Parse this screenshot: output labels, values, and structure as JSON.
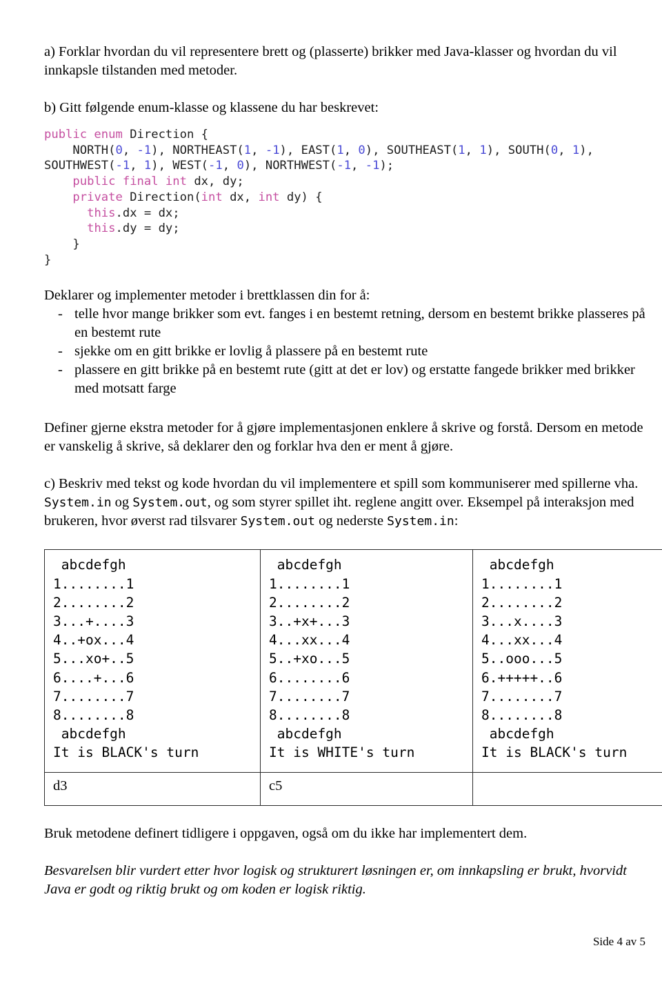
{
  "document": {
    "language": "no",
    "footer": "Side 4 av 5"
  },
  "sections": {
    "task_a": "a) Forklar hvordan du vil representere brett og (plasserte) brikker med Java-klasser og hvordan du vil innkapsle tilstanden med metoder.",
    "task_b_intro": "b) Gitt følgende enum-klasse og klassene du har beskrevet:",
    "declare_intro": "Deklarer og implementer metoder i brettklassen din for å:",
    "extra_methods": "Definer gjerne ekstra metoder for å gjøre implementasjonen enklere å skrive og forstå. Dersom en metode er vanskelig å skrive, så deklarer den og forklar hva den er ment å gjøre.",
    "use_methods": "Bruk metodene definert tidligere i oppgaven, også om du ikke har implementert dem.",
    "grading_note": "Besvarelsen blir vurdert etter hvor logisk og strukturert løsningen er, om innkapsling er brukt, hvorvidt Java er godt og riktig brukt og om koden er logisk riktig."
  },
  "task_c": {
    "part1": "c) Beskriv med tekst og kode hvordan du vil implementere et spill som kommuniserer med spillerne vha. ",
    "code1": "System.in",
    "part2": " og ",
    "code2": "System.out",
    "part3": ", og som styrer spillet iht. reglene angitt over. Eksempel på interaksjon med brukeren, hvor øverst rad tilsvarer ",
    "code3": "System.out",
    "part4": " og nederste ",
    "code4": "System.in",
    "part5": ":"
  },
  "bullets": [
    {
      "marker": "-",
      "text": "telle hvor mange brikker som evt. fanges i en bestemt retning, dersom en bestemt brikke plasseres på en bestemt rute"
    },
    {
      "marker": "-",
      "text": "sjekke om en gitt brikke er lovlig å plassere på en bestemt rute"
    },
    {
      "marker": "-",
      "text": "plassere en gitt brikke på en bestemt rute (gitt at det er lov) og erstatte fangede brikker med brikker med motsatt farge"
    }
  ],
  "code_block": {
    "language": "java",
    "colors": {
      "keyword": "#c54ea0",
      "number": "#4a4ad6",
      "plain": "#1d1d1d"
    },
    "lines": [
      [
        {
          "t": "public enum ",
          "c": "kw"
        },
        {
          "t": "Direction {",
          "c": "plain"
        }
      ],
      [
        {
          "t": "    NORTH(",
          "c": "plain"
        },
        {
          "t": "0",
          "c": "num"
        },
        {
          "t": ", ",
          "c": "plain"
        },
        {
          "t": "-1",
          "c": "num"
        },
        {
          "t": "), NORTHEAST(",
          "c": "plain"
        },
        {
          "t": "1",
          "c": "num"
        },
        {
          "t": ", ",
          "c": "plain"
        },
        {
          "t": "-1",
          "c": "num"
        },
        {
          "t": "), EAST(",
          "c": "plain"
        },
        {
          "t": "1",
          "c": "num"
        },
        {
          "t": ", ",
          "c": "plain"
        },
        {
          "t": "0",
          "c": "num"
        },
        {
          "t": "), SOUTHEAST(",
          "c": "plain"
        },
        {
          "t": "1",
          "c": "num"
        },
        {
          "t": ", ",
          "c": "plain"
        },
        {
          "t": "1",
          "c": "num"
        },
        {
          "t": "), SOUTH(",
          "c": "plain"
        },
        {
          "t": "0",
          "c": "num"
        },
        {
          "t": ", ",
          "c": "plain"
        },
        {
          "t": "1",
          "c": "num"
        },
        {
          "t": "),",
          "c": "plain"
        }
      ],
      [
        {
          "t": "SOUTHWEST(",
          "c": "plain"
        },
        {
          "t": "-1",
          "c": "num"
        },
        {
          "t": ", ",
          "c": "plain"
        },
        {
          "t": "1",
          "c": "num"
        },
        {
          "t": "), WEST(",
          "c": "plain"
        },
        {
          "t": "-1",
          "c": "num"
        },
        {
          "t": ", ",
          "c": "plain"
        },
        {
          "t": "0",
          "c": "num"
        },
        {
          "t": "), NORTHWEST(",
          "c": "plain"
        },
        {
          "t": "-1",
          "c": "num"
        },
        {
          "t": ", ",
          "c": "plain"
        },
        {
          "t": "-1",
          "c": "num"
        },
        {
          "t": ");",
          "c": "plain"
        }
      ],
      [
        {
          "t": "    ",
          "c": "plain"
        },
        {
          "t": "public final int",
          "c": "kw"
        },
        {
          "t": " dx, dy;",
          "c": "plain"
        }
      ],
      [
        {
          "t": "    ",
          "c": "plain"
        },
        {
          "t": "private",
          "c": "kw"
        },
        {
          "t": " Direction(",
          "c": "plain"
        },
        {
          "t": "int",
          "c": "kw"
        },
        {
          "t": " dx, ",
          "c": "plain"
        },
        {
          "t": "int",
          "c": "kw"
        },
        {
          "t": " dy) {",
          "c": "plain"
        }
      ],
      [
        {
          "t": "      ",
          "c": "plain"
        },
        {
          "t": "this",
          "c": "kw"
        },
        {
          "t": ".dx = dx;",
          "c": "plain"
        }
      ],
      [
        {
          "t": "      ",
          "c": "plain"
        },
        {
          "t": "this",
          "c": "kw"
        },
        {
          "t": ".dy = dy;",
          "c": "plain"
        }
      ],
      [
        {
          "t": "    }",
          "c": "plain"
        }
      ],
      [
        {
          "t": "}",
          "c": "plain"
        }
      ]
    ]
  },
  "boards_table": {
    "columns": [
      {
        "board_lines": [
          " abcdefgh",
          "1........1",
          "2........2",
          "3...+....3",
          "4..+ox...4",
          "5...xo+..5",
          "6....+...6",
          "7........7",
          "8........8",
          " abcdefgh",
          "It is BLACK's turn"
        ],
        "move": "d3"
      },
      {
        "board_lines": [
          " abcdefgh",
          "1........1",
          "2........2",
          "3..+x+...3",
          "4...xx...4",
          "5..+xo...5",
          "6........6",
          "7........7",
          "8........8",
          " abcdefgh",
          "It is WHITE's turn"
        ],
        "move": "c5"
      },
      {
        "board_lines": [
          " abcdefgh",
          "1........1",
          "2........2",
          "3...x....3",
          "4...xx...4",
          "5..ooo...5",
          "6.+++++..6",
          "7........7",
          "8........8",
          " abcdefgh",
          "It is BLACK's turn"
        ],
        "move": ""
      }
    ]
  }
}
